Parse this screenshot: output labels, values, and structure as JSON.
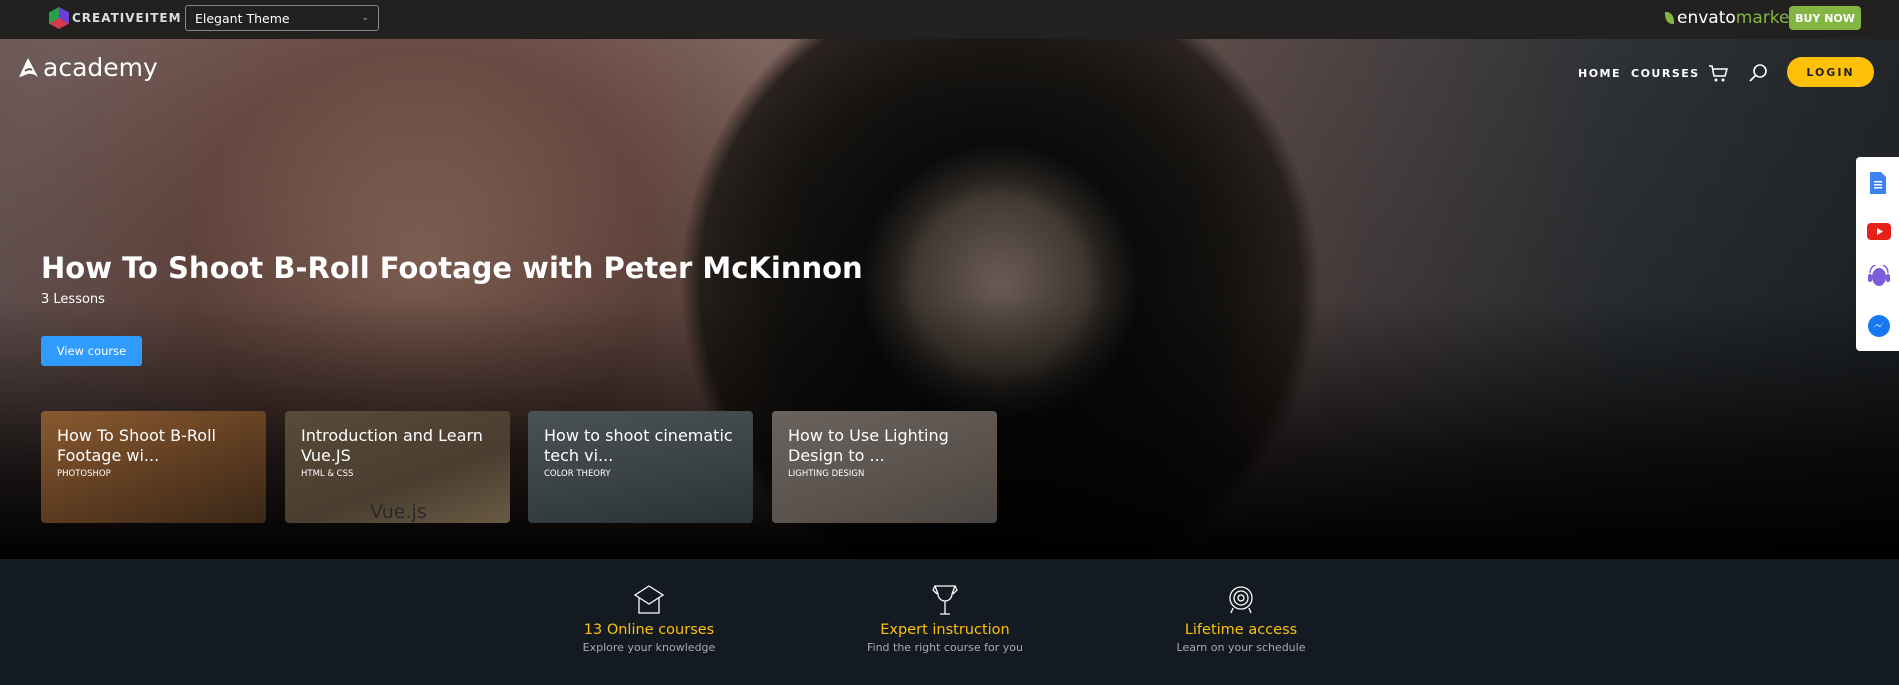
{
  "topbar": {
    "brand": "CREATIVEITEM",
    "theme_select": "Elegant Theme",
    "envato_1": "envato",
    "envato_2": "market",
    "buy_now": "BUY NOW"
  },
  "header": {
    "logo": "academy",
    "nav": [
      "HOME",
      "COURSES"
    ],
    "login": "LOGIN"
  },
  "hero": {
    "title": "How To Shoot B-Roll Footage with Peter McKinnon",
    "lessons": "3 Lessons",
    "cta": "View course"
  },
  "cards": [
    {
      "title": "How To Shoot B-Roll Footage wi...",
      "category": "PHOTOSHOP"
    },
    {
      "title": "Introduction and Learn Vue.JS",
      "category": "HTML & CSS",
      "image_text": "Vue.js"
    },
    {
      "title": "How to shoot cinematic tech vi...",
      "category": "COLOR THEORY"
    },
    {
      "title": "How to Use Lighting Design to ...",
      "category": "LIGHTING DESIGN"
    }
  ],
  "features": [
    {
      "icon": "graduation-cap-icon",
      "title": "13 Online courses",
      "subtitle": "Explore your knowledge"
    },
    {
      "icon": "trophy-icon",
      "title": "Expert instruction",
      "subtitle": "Find the right course for you"
    },
    {
      "icon": "target-icon",
      "title": "Lifetime access",
      "subtitle": "Learn on your schedule"
    }
  ],
  "widget": [
    "document-icon",
    "youtube-icon",
    "support-icon",
    "messenger-icon"
  ],
  "colors": {
    "accent": "#ffc107",
    "primary": "#2f9bff",
    "envato": "#82b541",
    "footer_bg": "#131a22"
  }
}
